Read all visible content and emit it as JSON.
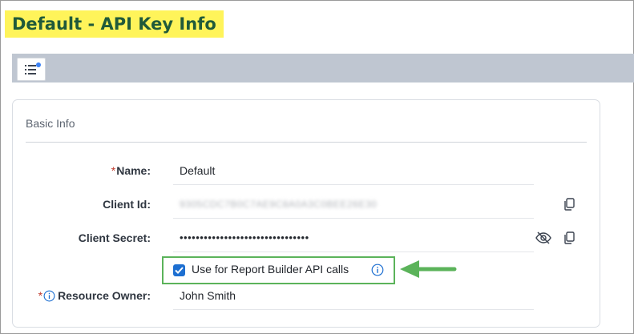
{
  "page": {
    "title": "Default - API Key Info"
  },
  "toolbar": {
    "list_button_icon": "list-icon"
  },
  "panel": {
    "title": "Basic Info",
    "fields": {
      "name": {
        "label": "Name:",
        "required_mark": "*",
        "value": "Default"
      },
      "client_id": {
        "label": "Client Id:",
        "value": "9305CDC7B0C7AE9C8A0A3C0BEE26E30"
      },
      "client_secret": {
        "label": "Client Secret:",
        "value": "••••••••••••••••••••••••••••••••"
      },
      "report_builder": {
        "label": "Use for Report Builder API calls",
        "checked": true
      },
      "resource_owner": {
        "label": "Resource Owner:",
        "required_mark": "*",
        "value": "John Smith"
      }
    }
  },
  "colors": {
    "title_highlight": "#fff45a",
    "title_text": "#205a3a",
    "checkbox": "#1d6fd1",
    "annotation_green": "#5bb35a"
  }
}
